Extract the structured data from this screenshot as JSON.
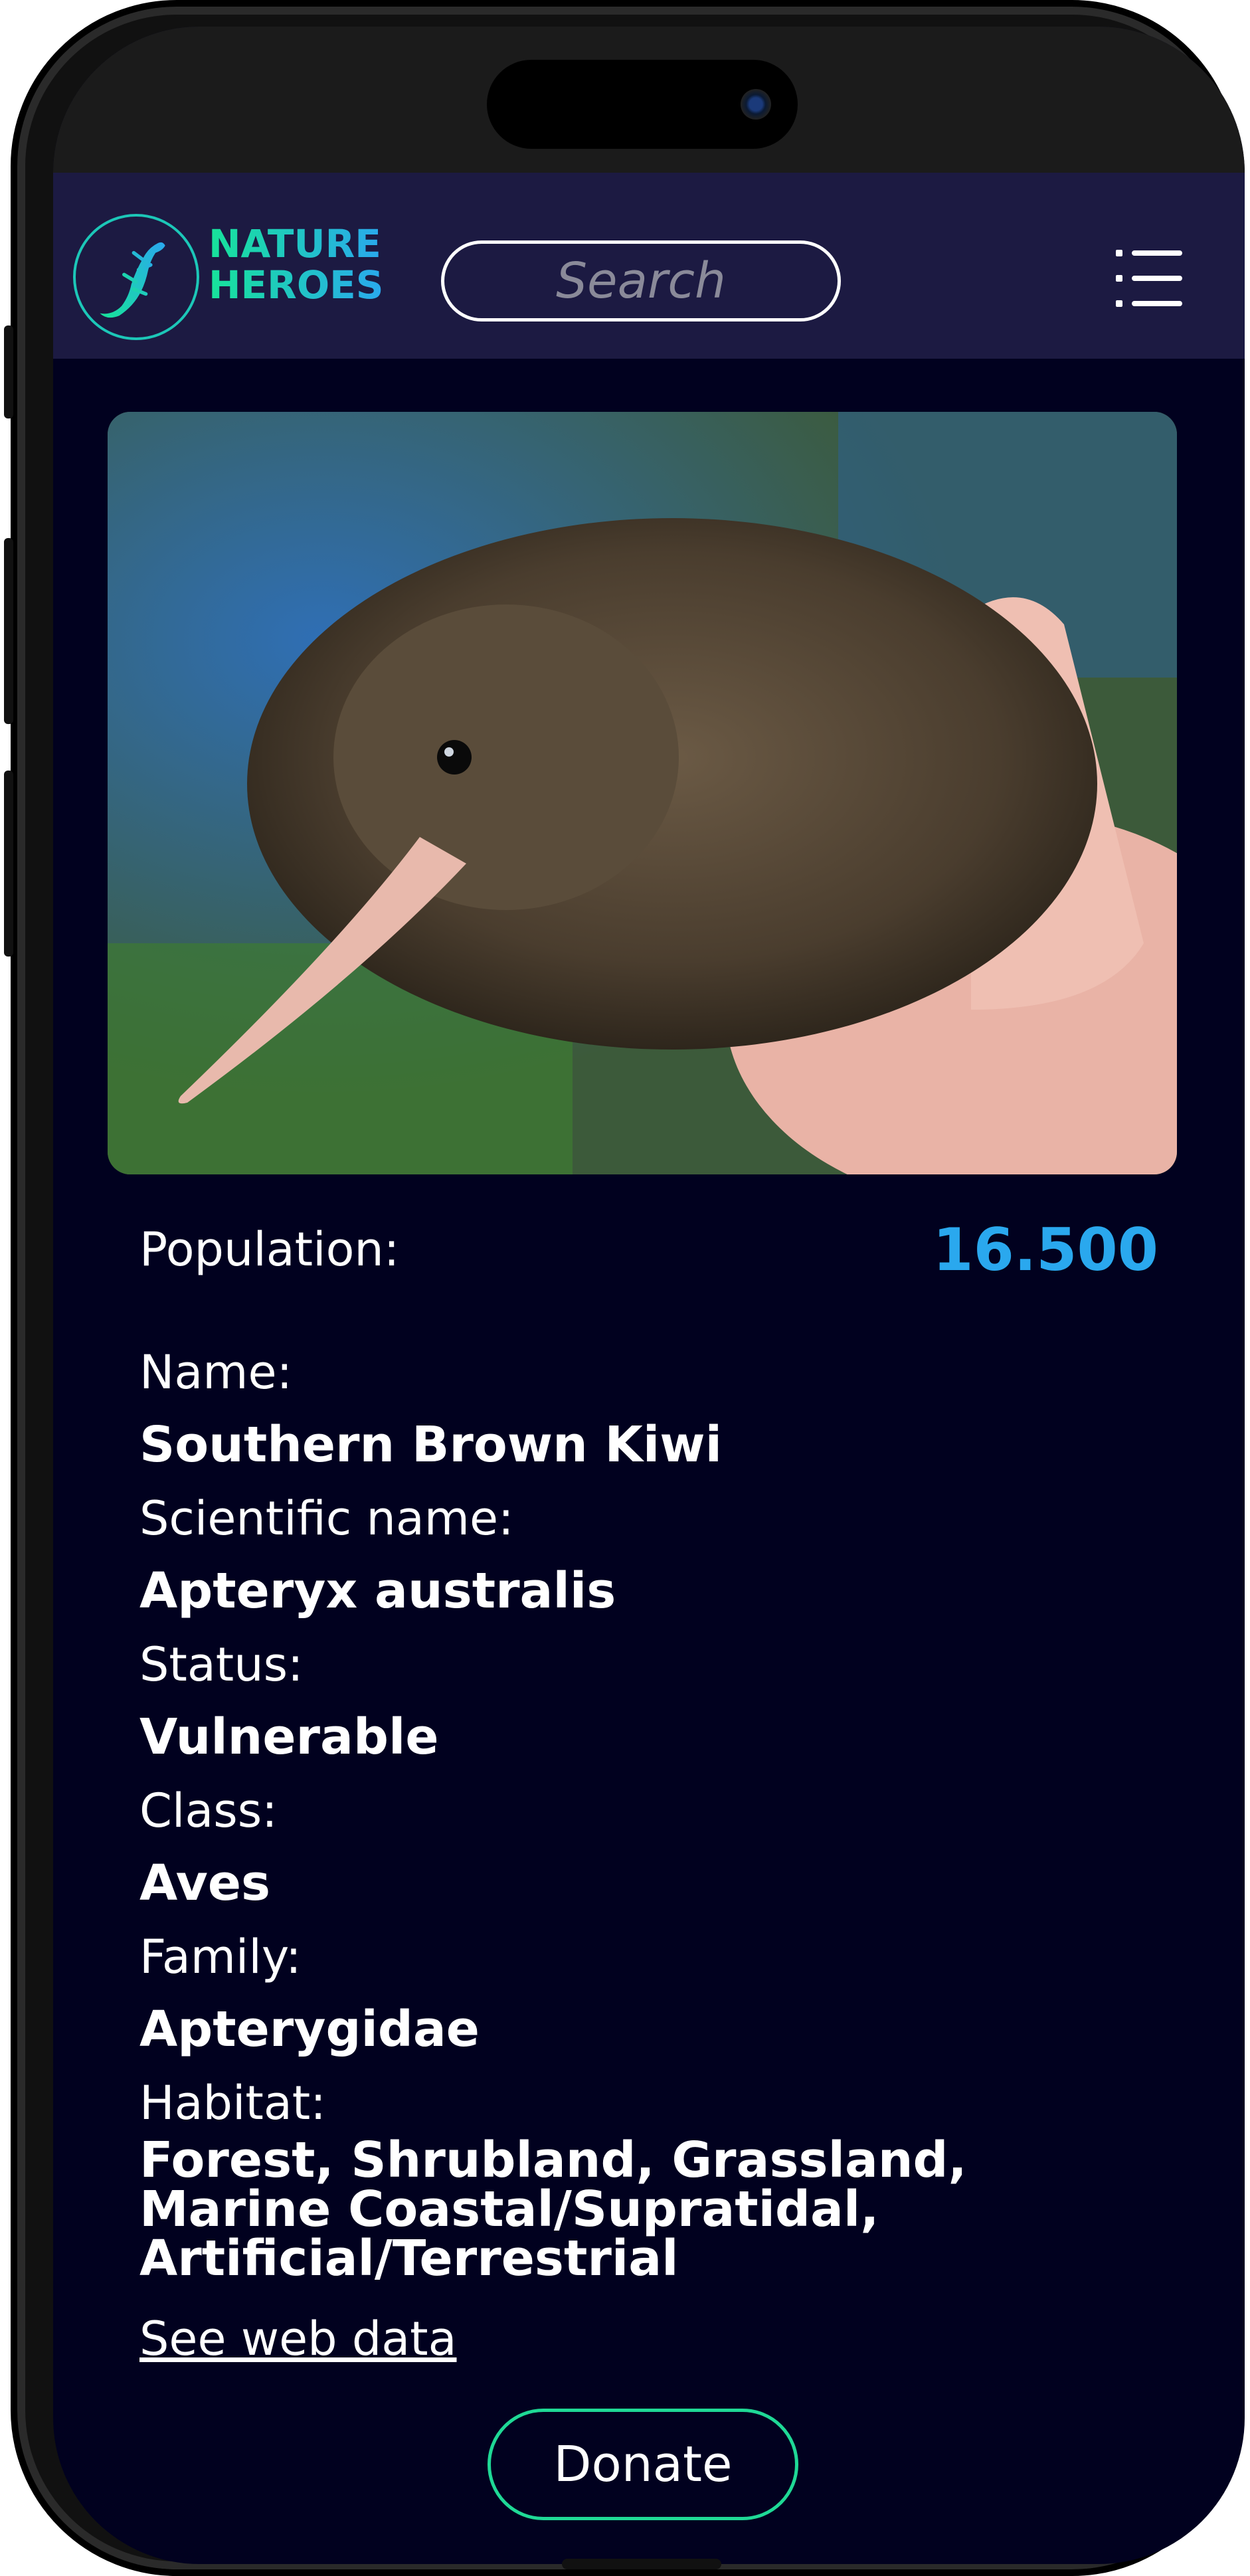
{
  "header": {
    "logo_line1": "NATURE",
    "logo_line2": "HEROES",
    "search_placeholder": "Search",
    "menu_icon": "list-icon"
  },
  "animal": {
    "image_alt": "Southern Brown Kiwi held in a hand",
    "population_label": "Population:",
    "population_value": "16.500",
    "fields": [
      {
        "label": "Name:",
        "value": "Southern Brown Kiwi"
      },
      {
        "label": "Scientific name:",
        "value": "Apteryx australis"
      },
      {
        "label": "Status:",
        "value": "Vulnerable"
      },
      {
        "label": "Class:",
        "value": "Aves"
      },
      {
        "label": "Family:",
        "value": "Apterygidae"
      },
      {
        "label": "Habitat:",
        "value": "Forest, Shrubland, Grassland, Marine Coastal/Supratidal, Artificial/Terrestrial"
      }
    ],
    "web_link": "See web data",
    "donate_label": "Donate"
  },
  "colors": {
    "background": "#01011f",
    "header": "#1c1a42",
    "accent_blue": "#2aa8ee",
    "accent_green": "#1fd996"
  }
}
